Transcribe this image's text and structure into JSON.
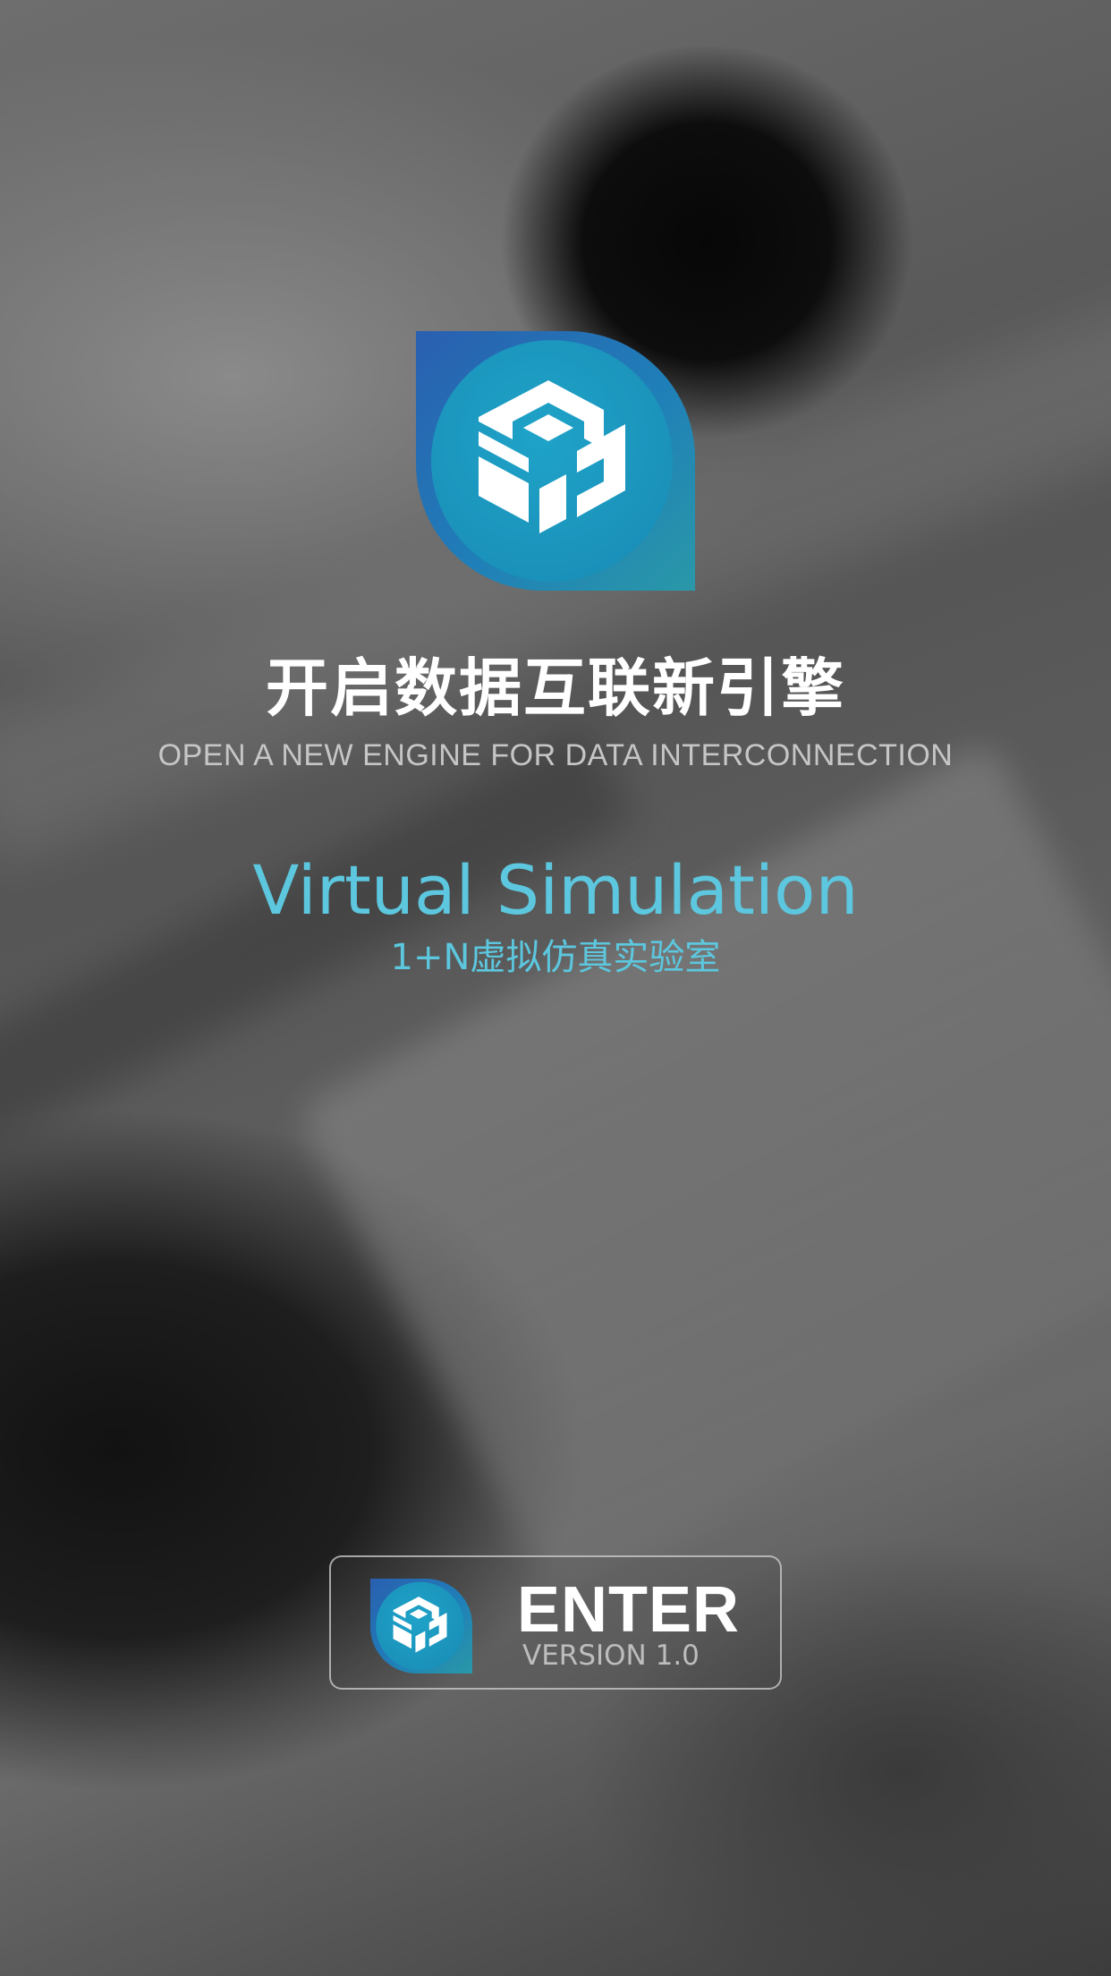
{
  "splash": {
    "logo_icon": "sd-cube-logo-icon",
    "headline_cn": "开启数据互联新引擎",
    "headline_en": "OPEN A NEW ENGINE FOR DATA INTERCONNECTION",
    "product_title": "Virtual Simulation",
    "product_subtitle": "1+N虚拟仿真实验室",
    "enter_button": {
      "label": "ENTER",
      "version": "VERSION 1.0",
      "icon": "sd-cube-logo-icon"
    }
  },
  "colors": {
    "accent_cyan": "#5cc7de",
    "logo_blue": "#2a66b4",
    "logo_teal": "#1e97b6",
    "headline_white": "#ffffff",
    "headline_en_gray": "#c6c6c6"
  }
}
